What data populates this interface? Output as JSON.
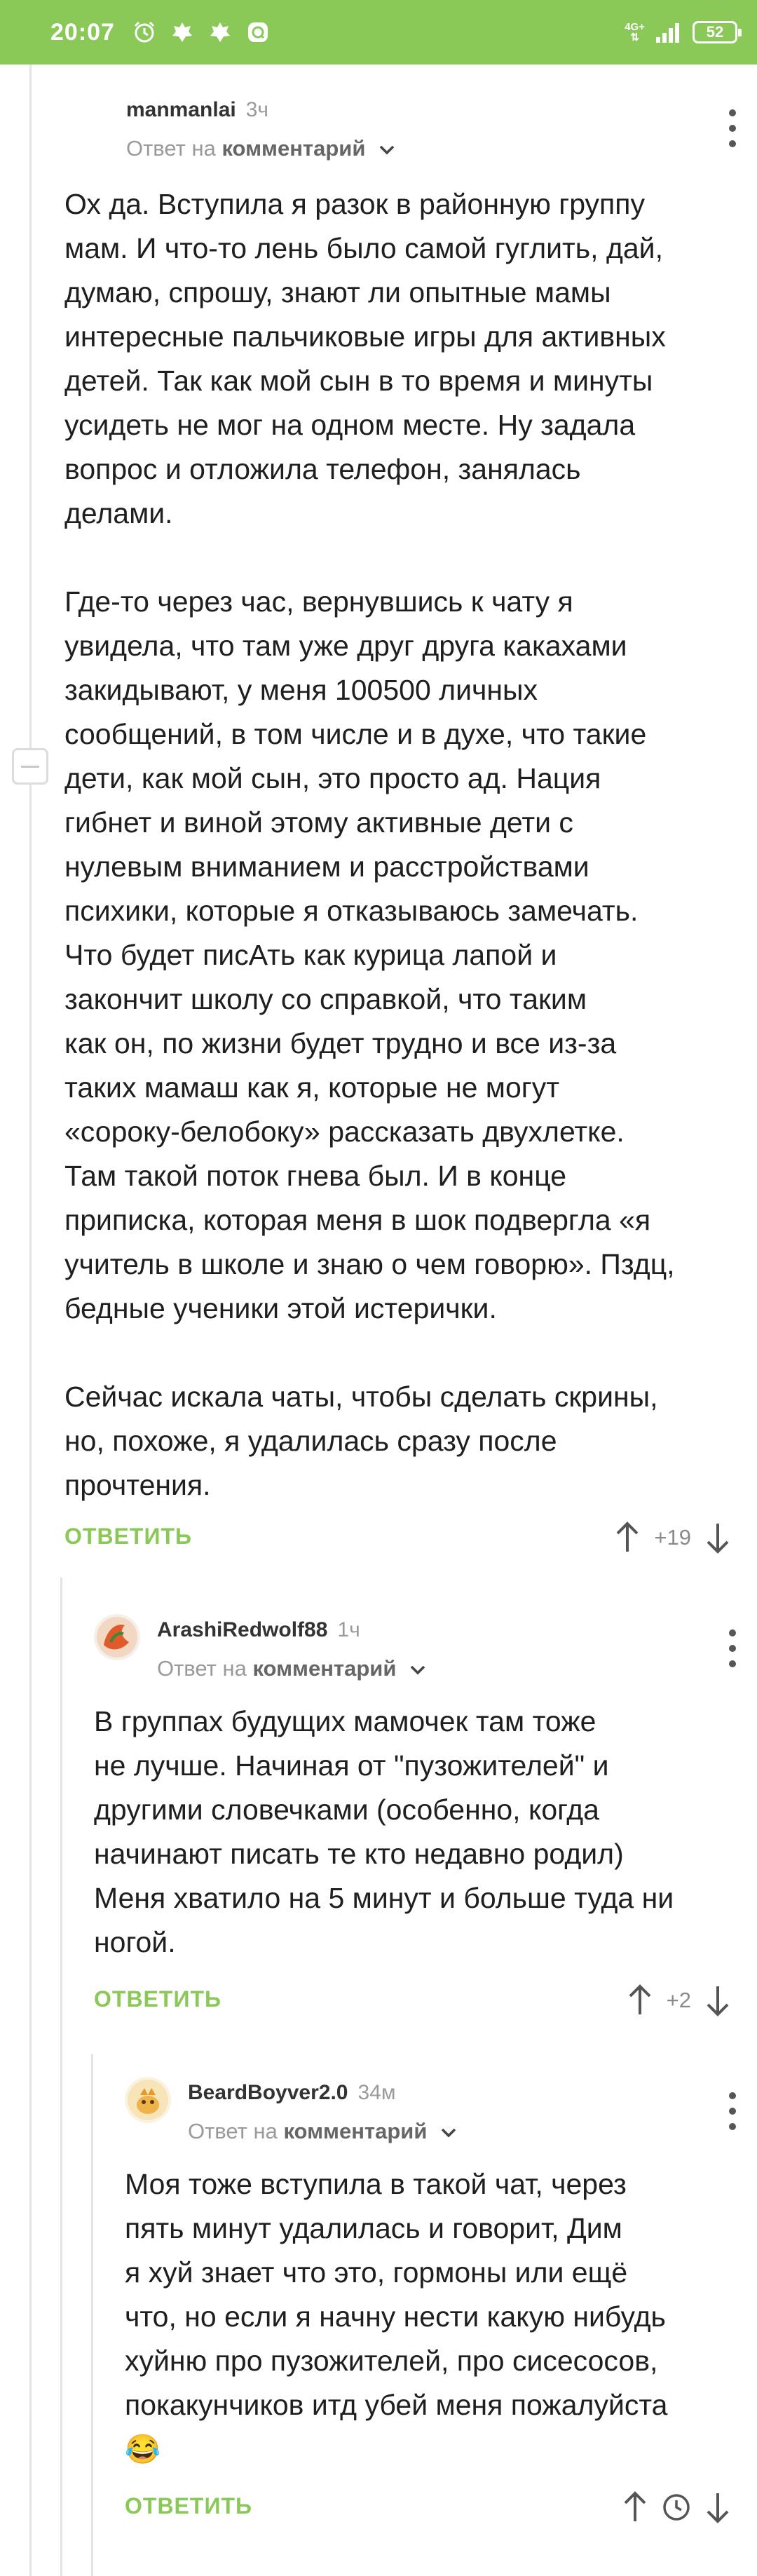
{
  "status": {
    "time": "20:07",
    "net_top": "4G+",
    "net_bottom": "⇅",
    "battery": "52"
  },
  "comments": [
    {
      "author": "manmanlai",
      "time": "3ч",
      "reply_prefix": "Ответ на",
      "reply_target": "комментарий",
      "text": "Ох да. Вступила я разок в районную группу\nмам. И что-то лень было самой гуглить, дай,\nдумаю, спрошу, знают ли опытные мамы\nинтересные пальчиковые игры для активных\nдетей. Так как мой сын в то время и минуты\nусидеть не мог на одном месте. Ну задала\nвопрос и отложила телефон, занялась\nделами.\n\nГде-то через час, вернувшись к чату я\nувидела, что там уже друг друга какахами\nзакидывают, у меня 100500 личных\nсообщений, в том числе и в духе, что такие\nдети, как мой сын, это просто ад. Нация\nгибнет и виной этому активные дети с\nнулевым вниманием и расстройствами\nпсихики, которые я отказываюсь замечать.\nЧто будет писАть как курица лапой и\nзакончит школу со справкой, что таким\nкак он, по жизни будет трудно и все из-за\nтаких мамаш как я, которые не могут\n«сороку-белобоку» рассказать двухлетке.\nТам такой поток гнева был. И в конце\nприписка, которая меня в шок подвергла «я\nучитель в школе и знаю о чем говорю». Пздц,\nбедные ученики этой истерички.\n\nСейчас искала чаты, чтобы сделать скрины,\nно, похоже, я удалилась сразу после\nпрочтения.",
      "reply_label": "ОТВЕТИТЬ",
      "rating": "+19"
    },
    {
      "author": "ArashiRedwolf88",
      "time": "1ч",
      "reply_prefix": "Ответ на",
      "reply_target": "комментарий",
      "text": "В группах будущих мамочек там тоже\nне лучше. Начиная от \"пузожителей\" и\nдругими словечками (особенно, когда\nначинают писать те кто недавно родил)\nМеня хватило на 5 минут и больше туда ни\nногой.",
      "reply_label": "ОТВЕТИТЬ",
      "rating": "+2"
    },
    {
      "author": "BeardBoyver2.0",
      "time": "34м",
      "reply_prefix": "Ответ на",
      "reply_target": "комментарий",
      "text": "Моя тоже вступила в такой чат, через\nпять минут удалилась и говорит, Дим\nя хуй знает что это, гормоны или ещё\nчто, но если я начну нести какую нибудь\nхуйню про пузожителей, про сисесосов,\nпокакунчиков итд убей меня пожалуйста",
      "emoji": "😂",
      "reply_label": "ОТВЕТИТЬ"
    }
  ],
  "icons": [
    "alarm-icon",
    "emblem-icon",
    "emblem-icon",
    "chat-app-icon",
    "signal-icon",
    "battery-icon",
    "upvote-icon",
    "downvote-icon",
    "clock-icon",
    "more-icon",
    "chevron-down-icon",
    "collapse-icon"
  ],
  "colors": {
    "accent": "#8ac858",
    "muted": "#9a9a9a",
    "text": "#1f1f1f"
  }
}
